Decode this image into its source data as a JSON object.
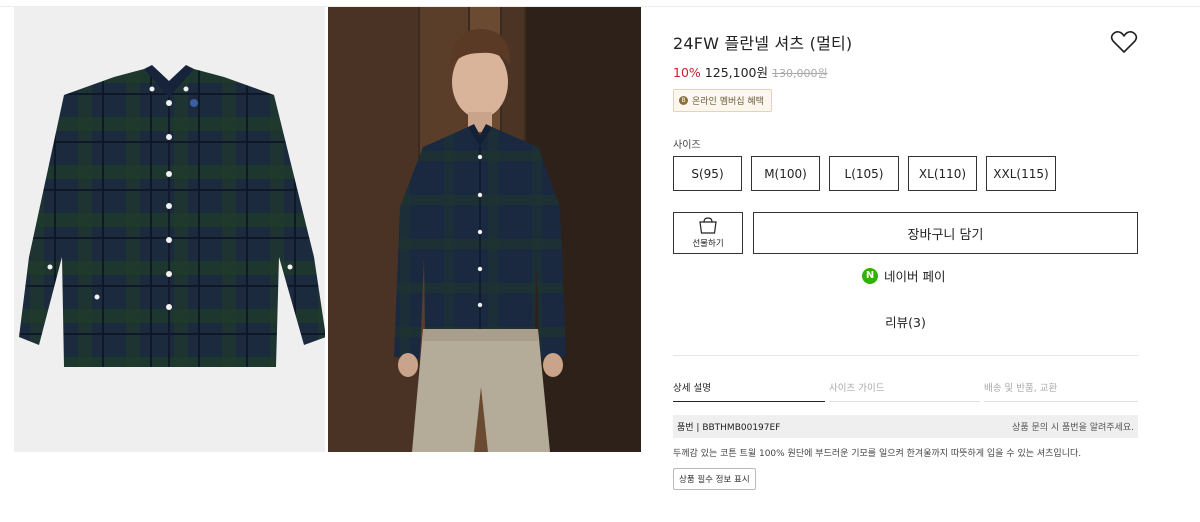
{
  "product": {
    "title": "24FW 플란넬 셔츠 (멀티)",
    "discount": "10%",
    "price": "125,100원",
    "original_price": "130,000원",
    "badge": "온라인 멤버십 혜택",
    "badge_icon": "membership-icon"
  },
  "sizes": {
    "label": "사이즈",
    "options": [
      "S(95)",
      "M(100)",
      "L(105)",
      "XL(110)",
      "XXL(115)"
    ]
  },
  "actions": {
    "gift_label": "선물하기",
    "cart_label": "장바구니 담기",
    "npay_mark": "N",
    "npay_label": "네이버 페이",
    "review_label": "리뷰(3)"
  },
  "tabs": [
    "상세 설명",
    "사이즈 가이드",
    "배송 및 반품, 교환"
  ],
  "detail": {
    "code": "품번 | BBTHMB00197EF",
    "code_hint": "상품 문의 시 품번을 알려주세요.",
    "description": "두께감 있는 코튼 트윌 100% 원단에 부드러운 기모를 일으켜 한겨울까지 따뜻하게 입을 수 있는 셔츠입니다.",
    "notice_button": "상품 필수 정보 표시"
  },
  "colors": {
    "discount": "#c8202f",
    "npay_green": "#2db400",
    "shirt_navy": "#1c2a3e",
    "shirt_green": "#1f3a2c",
    "chino": "#b5ab99"
  }
}
